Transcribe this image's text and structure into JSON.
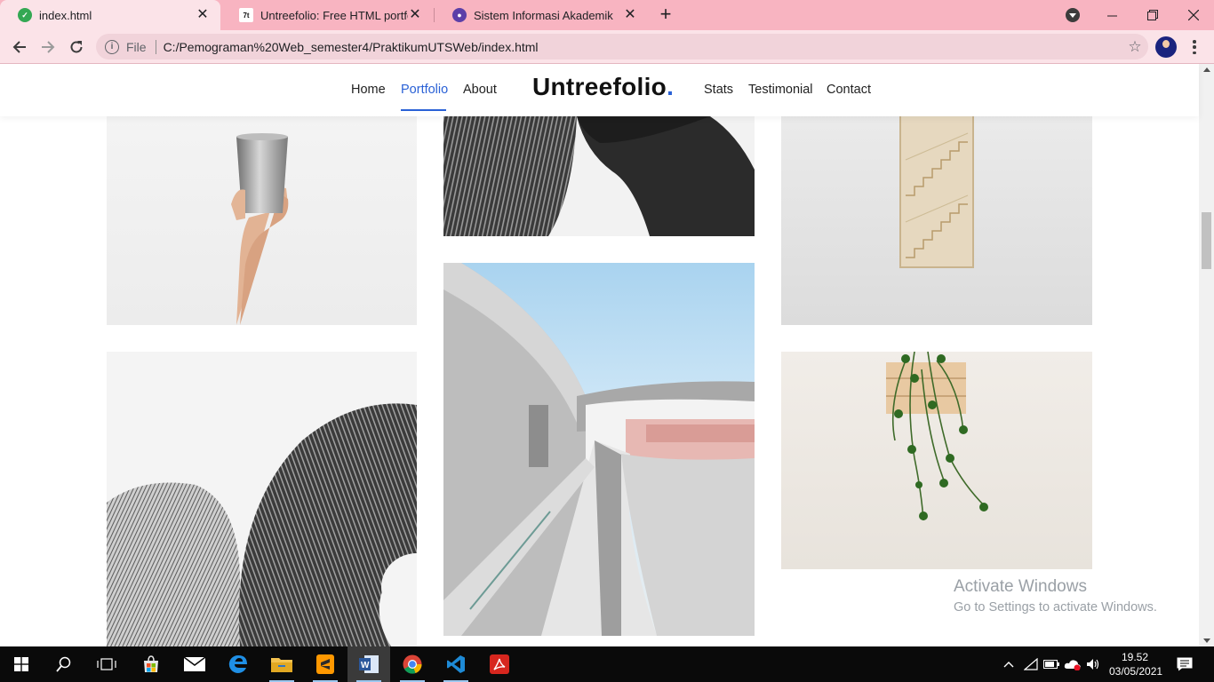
{
  "browser": {
    "tabs": [
      {
        "title": "index.html",
        "active": true
      },
      {
        "title": "Untreefolio: Free HTML portfolio",
        "active": false
      },
      {
        "title": "Sistem Informasi Akademik",
        "active": false
      }
    ],
    "address": {
      "scheme_label": "File",
      "url": "C:/Pemograman%20Web_semester4/PraktikumUTSWeb/index.html"
    }
  },
  "site": {
    "brand": "Untreefolio",
    "brand_dot": ".",
    "nav": {
      "home": "Home",
      "portfolio": "Portfolio",
      "about": "About",
      "stats": "Stats",
      "testimonial": "Testimonial",
      "contact": "Contact"
    },
    "accent_color": "#2a61d6"
  },
  "watermark": {
    "title": "Activate Windows",
    "subtitle": "Go to Settings to activate Windows."
  },
  "taskbar": {
    "time": "19.52",
    "date": "03/05/2021"
  }
}
